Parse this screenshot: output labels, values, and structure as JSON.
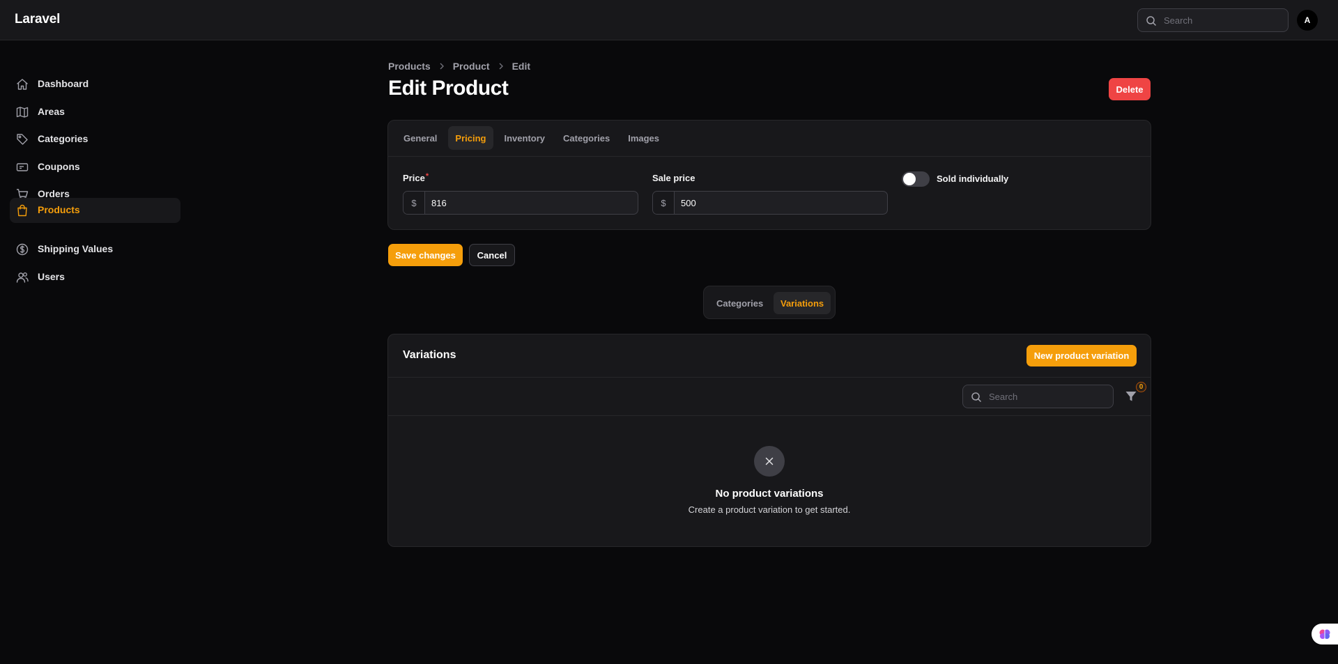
{
  "app": {
    "brand": "Laravel",
    "avatar_initial": "A"
  },
  "top_search": {
    "placeholder": "Search"
  },
  "sidebar": {
    "items": [
      {
        "label": "Dashboard",
        "icon": "home-icon",
        "active": false
      },
      {
        "label": "Areas",
        "icon": "map-icon",
        "active": false
      },
      {
        "label": "Categories",
        "icon": "tag-icon",
        "active": false
      },
      {
        "label": "Coupons",
        "icon": "ticket-icon",
        "active": false
      },
      {
        "label": "Orders",
        "icon": "cart-icon",
        "active": false
      },
      {
        "label": "Products",
        "icon": "shopping-bag-icon",
        "active": true
      },
      {
        "label": "Shipping Values",
        "icon": "dollar-circle-icon",
        "active": false
      },
      {
        "label": "Users",
        "icon": "users-icon",
        "active": false
      }
    ]
  },
  "breadcrumb": [
    "Products",
    "Product",
    "Edit"
  ],
  "page": {
    "title": "Edit Product",
    "delete_label": "Delete"
  },
  "form": {
    "tabs": [
      "General",
      "Pricing",
      "Inventory",
      "Categories",
      "Images"
    ],
    "active_tab": "Pricing",
    "price": {
      "label": "Price",
      "required_mark": "*",
      "prefix": "$",
      "value": "816"
    },
    "sale_price": {
      "label": "Sale price",
      "prefix": "$",
      "value": "500"
    },
    "sold_individually": {
      "label": "Sold individually",
      "checked": false
    }
  },
  "actions": {
    "save_label": "Save changes",
    "cancel_label": "Cancel"
  },
  "relation_tabs": {
    "items": [
      "Categories",
      "Variations"
    ],
    "active": "Variations"
  },
  "variations": {
    "title": "Variations",
    "new_label": "New product variation",
    "search_placeholder": "Search",
    "filter_count": "0",
    "empty_title": "No product variations",
    "empty_subtitle": "Create a product variation to get started."
  },
  "colors": {
    "accent": "#f59e0b",
    "danger": "#ef4444",
    "background": "#09090b",
    "surface": "#18181b"
  }
}
